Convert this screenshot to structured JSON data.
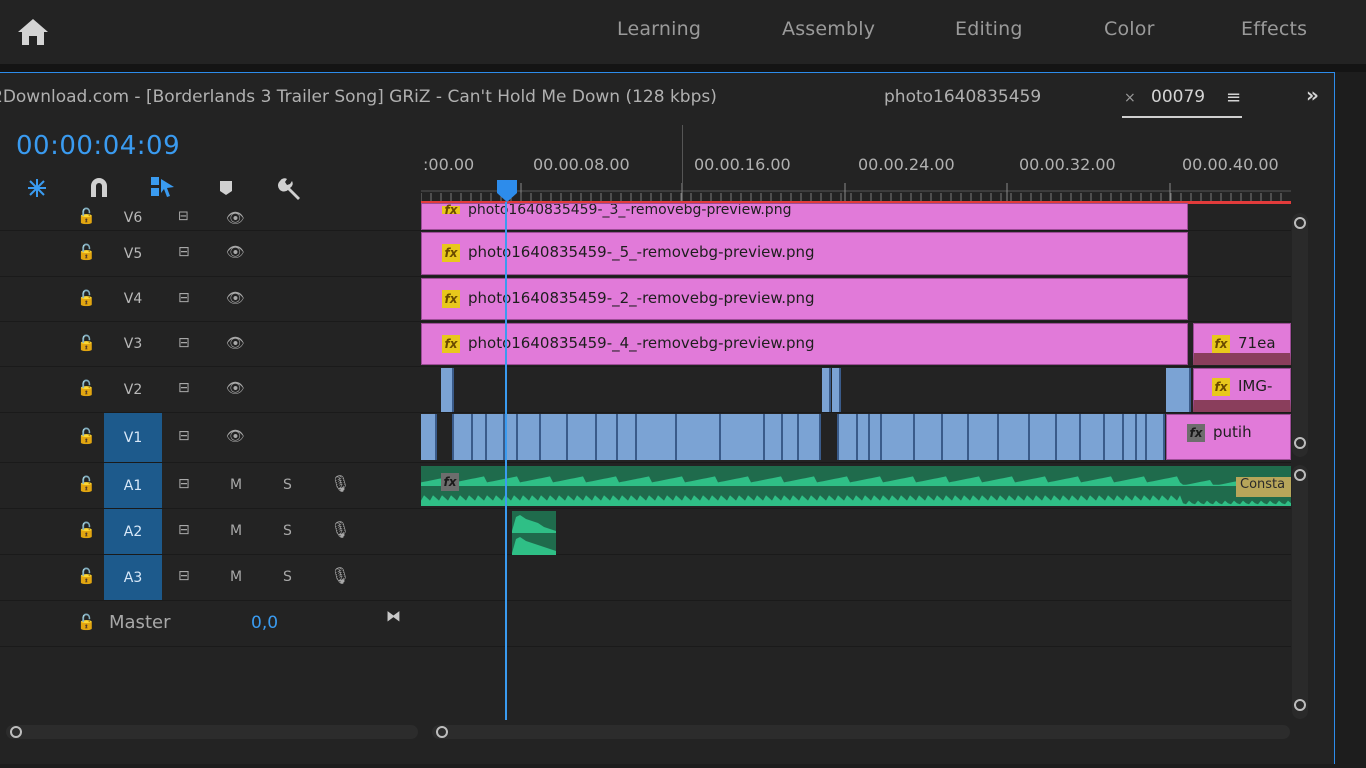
{
  "workspaces": [
    "Learning",
    "Assembly",
    "Editing",
    "Color",
    "Effects"
  ],
  "tabs": {
    "sequence_audio": "2Download.com - [Borderlands 3 Trailer Song] GRiZ - Can't Hold Me Down (128 kbps)",
    "photo_sequence": "photo1640835459",
    "close_glyph": "×",
    "active_sequence": "00079",
    "menu_glyph": "≡",
    "overflow_glyph": "»"
  },
  "timeline": {
    "timecode": "00:00:04:09",
    "ruler_labels": [
      ":00.00",
      "00.00.08.00",
      "00.00.16.00",
      "00.00.24.00",
      "00.00.32.00",
      "00.00.40.00"
    ]
  },
  "tracks": {
    "video": [
      {
        "name": "V6"
      },
      {
        "name": "V5"
      },
      {
        "name": "V4"
      },
      {
        "name": "V3"
      },
      {
        "name": "V2"
      },
      {
        "name": "V1"
      }
    ],
    "audio": [
      {
        "name": "A1",
        "m": "M",
        "s": "S"
      },
      {
        "name": "A2",
        "m": "M",
        "s": "S"
      },
      {
        "name": "A3",
        "m": "M",
        "s": "S"
      }
    ],
    "master_label": "Master",
    "master_value": "0,0"
  },
  "clips": {
    "v6": "photo1640835459-_3_-removebg-preview.png",
    "v5": "photo1640835459-_5_-removebg-preview.png",
    "v4": "photo1640835459-_2_-removebg-preview.png",
    "v3": "photo1640835459-_4_-removebg-preview.png",
    "v3_end": "71ea",
    "v2_end": "IMG-",
    "v1_end": "putih",
    "a1_end": "Consta",
    "fx": "fx"
  },
  "colors": {
    "accent": "#2d8ceb",
    "pink_clip": "#e17ad9",
    "blue_clip": "#7ba3d4",
    "audio_clip": "#2fbf86",
    "fx_badge": "#e8c81c",
    "selected_track": "#1d5a8c"
  }
}
